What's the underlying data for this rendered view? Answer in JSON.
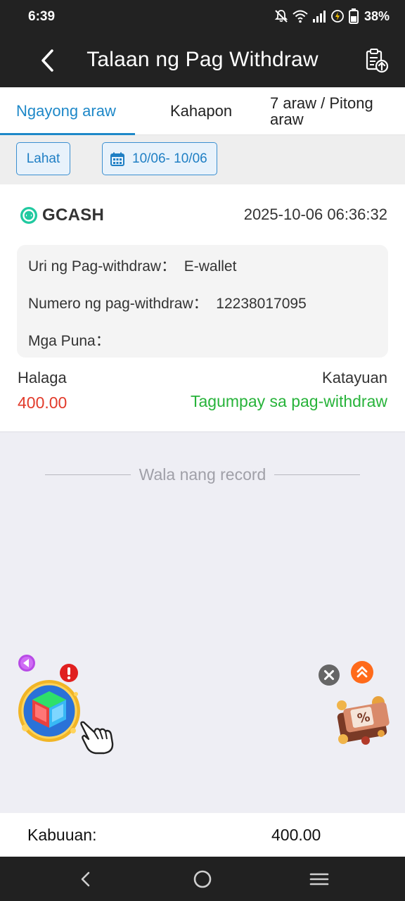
{
  "status_bar": {
    "time": "6:39",
    "battery_percent": "38%",
    "icons": [
      "mute-bell-icon",
      "wifi-icon",
      "signal-icon",
      "battery-saver-icon",
      "battery-icon"
    ]
  },
  "app_bar": {
    "title": "Talaan ng Pag Withdraw",
    "back_icon": "chevron-left-icon",
    "action_icon": "document-upload-icon"
  },
  "tabs": [
    {
      "label": "Ngayong araw",
      "active": true
    },
    {
      "label": "Kahapon",
      "active": false
    },
    {
      "label": "7 araw / Pitong araw",
      "active": false
    }
  ],
  "filters": {
    "all_label": "Lahat",
    "date_range": "10/06- 10/06",
    "date_icon": "calendar-icon"
  },
  "record": {
    "provider": "GCASH",
    "datetime": "2025-10-06 06:36:32",
    "type_label": "Uri ng Pag-withdraw：",
    "type_value": "E-wallet",
    "number_label": "Numero ng pag-withdraw：",
    "number_value": "12238017095",
    "remarks_label": "Mga Puna：",
    "amount_label": "Halaga",
    "amount_value": "400.00",
    "status_label": "Katayuan",
    "status_value": "Tagumpay sa pag-withdraw"
  },
  "empty_message": "Wala nang record",
  "floating": {
    "left_widget": "game-cube-wheel-icon",
    "right_widget": "discount-gift-icon"
  },
  "total": {
    "label": "Kabuuan:",
    "value": "400.00"
  },
  "colors": {
    "accent": "#1e88c8",
    "amount": "#e23b2b",
    "success": "#27b33a",
    "header": "#222222"
  }
}
